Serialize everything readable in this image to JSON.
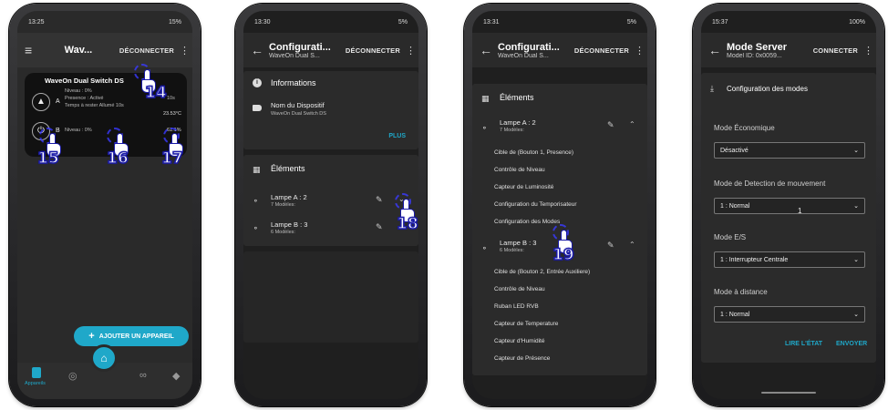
{
  "phone1": {
    "status_time": "13:25",
    "status_right": "15%",
    "title": "Wav...",
    "action": "DÉCONNECTER",
    "device_name": "WaveOn Dual Switch DS",
    "channel_a": {
      "letter": "A",
      "line1": "Niveau : 0%",
      "line2": "Presence : Activé",
      "line3": "Temps à rester Allumé 10s",
      "value1": "10s",
      "value2": "23.53°C"
    },
    "channel_b": {
      "letter": "B",
      "line1": "Niveau : 0%",
      "value": "61.1%"
    },
    "add_button": "AJOUTER UN APPAREIL",
    "nav_label": "Appareils",
    "callouts": [
      "14",
      "15",
      "16",
      "17"
    ]
  },
  "phone2": {
    "status_time": "13:30",
    "status_right": "5%",
    "title": "Configurati...",
    "subtitle": "WaveOn Dual S...",
    "action": "DÉCONNECTER",
    "informations": "Informations",
    "device_name_label": "Nom du Dispositif",
    "device_name_value": "WaveOn Dual Switch DS",
    "plus": "PLUS",
    "elements": "Éléments",
    "lamp_a": "Lampe A : 2",
    "lamp_a_sub": "7 Modèles:",
    "lamp_b": "Lampe B : 3",
    "lamp_b_sub": "6 Modèles:",
    "callout": "18"
  },
  "phone3": {
    "status_time": "13:31",
    "status_right": "5%",
    "title": "Configurati...",
    "subtitle": "WaveOn Dual S...",
    "action": "DÉCONNECTER",
    "elements": "Éléments",
    "lamp_a": "Lampe A : 2",
    "lamp_a_sub": "7 Modèles:",
    "lamp_a_items": [
      "Cible de (Bouton 1, Presence)",
      "Contrôle de Niveau",
      "Capteur de Luminosité",
      "Configuration du Temporisateur",
      "Configuration des Modes"
    ],
    "lamp_b": "Lampe B : 3",
    "lamp_b_sub": "6 Modèles:",
    "lamp_b_items": [
      "Cible de (Bouton 2, Entrée Auxiliere)",
      "Contrôle de Niveau",
      "Ruban LED RVB",
      "Capteur de Temperature",
      "Capteur d'Humidité",
      "Capteur de Présence"
    ],
    "callout": "19"
  },
  "phone4": {
    "status_time": "15:37",
    "status_right": "100%",
    "title": "Mode Server",
    "subtitle": "Model ID: 0x0059...",
    "action": "CONNECTER",
    "section": "Configuration des modes",
    "fields": [
      {
        "label": "Mode Économique",
        "value": "Désactivé"
      },
      {
        "label": "Mode de Detection de mouvement",
        "value": "1 : Normal"
      },
      {
        "label": "Mode E/S",
        "value": "1 : Interrupteur Centrale"
      },
      {
        "label": "Mode à distance",
        "value": "1 : Normal"
      }
    ],
    "stray": "1",
    "read_btn": "LIRE L'ÉTAT",
    "send_btn": "ENVOYER"
  },
  "colors": {
    "accent": "#1fa8c9",
    "screen_bg": "#1f1f1f",
    "card_bg": "#2b2b2b",
    "callout_blue": "#1a1aa8"
  }
}
